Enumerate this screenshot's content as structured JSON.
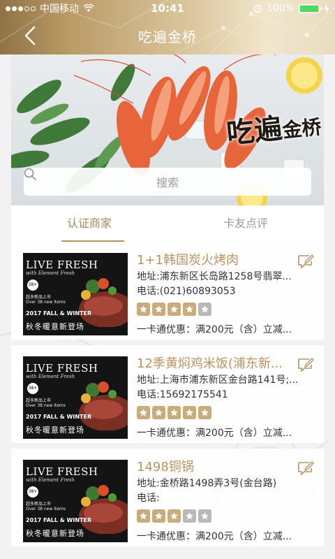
{
  "status_bar": {
    "carrier": "中国移动",
    "time": "10:41",
    "battery": "100%"
  },
  "nav": {
    "title": "吃遍金桥",
    "back_icon": "chevron-left-icon"
  },
  "banner": {
    "logo_text_large": "吃遍",
    "logo_text_small": "金桥"
  },
  "search": {
    "placeholder": "搜索",
    "icon": "search-icon"
  },
  "tabs": [
    {
      "label": "认证商家",
      "active": true
    },
    {
      "label": "卡友点评",
      "active": false
    }
  ],
  "thumb": {
    "title": "LIVE FRESH",
    "subtitle": "with Element Fresh",
    "badge": "38+",
    "line1": "超多新品上市",
    "line2": "Over 38 new items",
    "season": "2017 FALL & WINTER",
    "slogan": "秋冬暖意新登场",
    "brand": "element fresh"
  },
  "merchants": [
    {
      "name": "1+1韩国炭火烤肉",
      "address": "地址:浦东新区长岛路1258号翡翠...",
      "phone": "电话:(021)60893053",
      "rating": 4,
      "promo": "一卡通优惠：满200元（含）立减..."
    },
    {
      "name": "12季黄焖鸡米饭(浦东新...",
      "address": "地址:上海市浦东新区金台路141号;...",
      "phone": "电话:15692175541",
      "rating": 5,
      "promo": "一卡通优惠：满200元（含）立减..."
    },
    {
      "name": "1498铜锅",
      "address": "地址:金桥路1498弄3号(金台路)",
      "phone": "电话:",
      "rating": 3,
      "promo": "一卡通优惠：满200元（含）立减..."
    }
  ],
  "colors": {
    "gold": "#b89462",
    "star_on": "#c9ac7c",
    "star_off": "#b8b8b8"
  }
}
